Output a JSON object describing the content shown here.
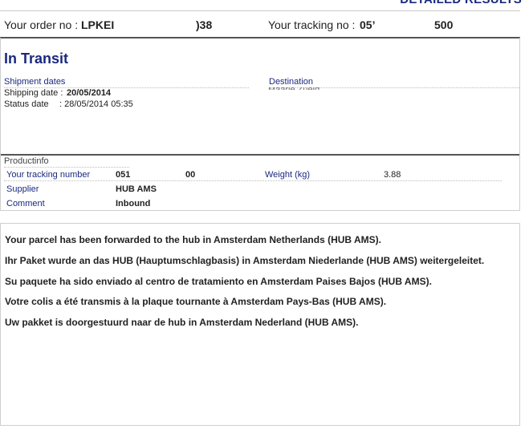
{
  "page_heading": "DETAILED RESULTS",
  "order": {
    "order_label": "Your order no :",
    "order_value_start": "LPKEI",
    "order_value_end": ")38",
    "tracking_label": "Your tracking no :",
    "tracking_value_start": "05’",
    "tracking_value_end": "500"
  },
  "shipment": {
    "status": "In Transit",
    "dates_header": "Shipment dates",
    "shipping_date_label": "Shipping date :",
    "shipping_date_value": "20/05/2014",
    "status_date_label": "Status date",
    "status_date_value": ": 28/05/2014 05:35",
    "destination_header": "Destination",
    "destination_value": "Maarle Zueld"
  },
  "productinfo": {
    "header": "Productinfo",
    "tracking_number_label": "Your tracking number",
    "tracking_number_part1": "051",
    "tracking_number_part2": "00",
    "weight_label": "Weight (kg)",
    "weight_value": "3.88",
    "supplier_label": "Supplier",
    "supplier_value": "HUB AMS",
    "comment_label": "Comment",
    "comment_value": "Inbound"
  },
  "messages": [
    "Your parcel has been forwarded to the hub in Amsterdam Netherlands (HUB AMS).",
    "Ihr Paket wurde an das HUB (Hauptumschlagbasis) in Amsterdam Niederlande (HUB AMS) weitergeleitet.",
    "Su paquete ha sido enviado al centro de tratamiento en Amsterdam Paises Bajos (HUB AMS).",
    "Votre colis a été transmis à la plaque tournante à Amsterdam Pays-Bas (HUB AMS).",
    "Uw pakket is doorgestuurd naar de hub in Amsterdam Nederland (HUB AMS)."
  ],
  "colors": {
    "heading_blue": "#1a2980",
    "border": "#cfcfcf",
    "divider": "#555555"
  }
}
